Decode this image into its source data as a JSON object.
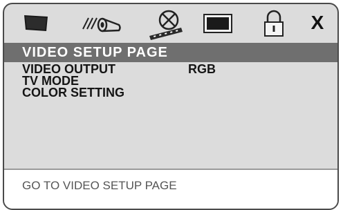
{
  "menu": {
    "icons": [
      {
        "name": "general-setup-icon"
      },
      {
        "name": "audio-setup-icon"
      },
      {
        "name": "video-setup-icon"
      },
      {
        "name": "preference-icon"
      },
      {
        "name": "password-lock-icon"
      },
      {
        "name": "exit-icon",
        "label": "X"
      }
    ],
    "selected_icon": "video-setup-icon"
  },
  "page": {
    "title": "VIDEO SETUP PAGE",
    "items": [
      {
        "label": "VIDEO OUTPUT",
        "value": "RGB"
      },
      {
        "label": "TV MODE",
        "value": ""
      },
      {
        "label": "COLOR SETTING",
        "value": ""
      }
    ]
  },
  "footer": {
    "hint": "GO TO VIDEO SETUP PAGE"
  }
}
